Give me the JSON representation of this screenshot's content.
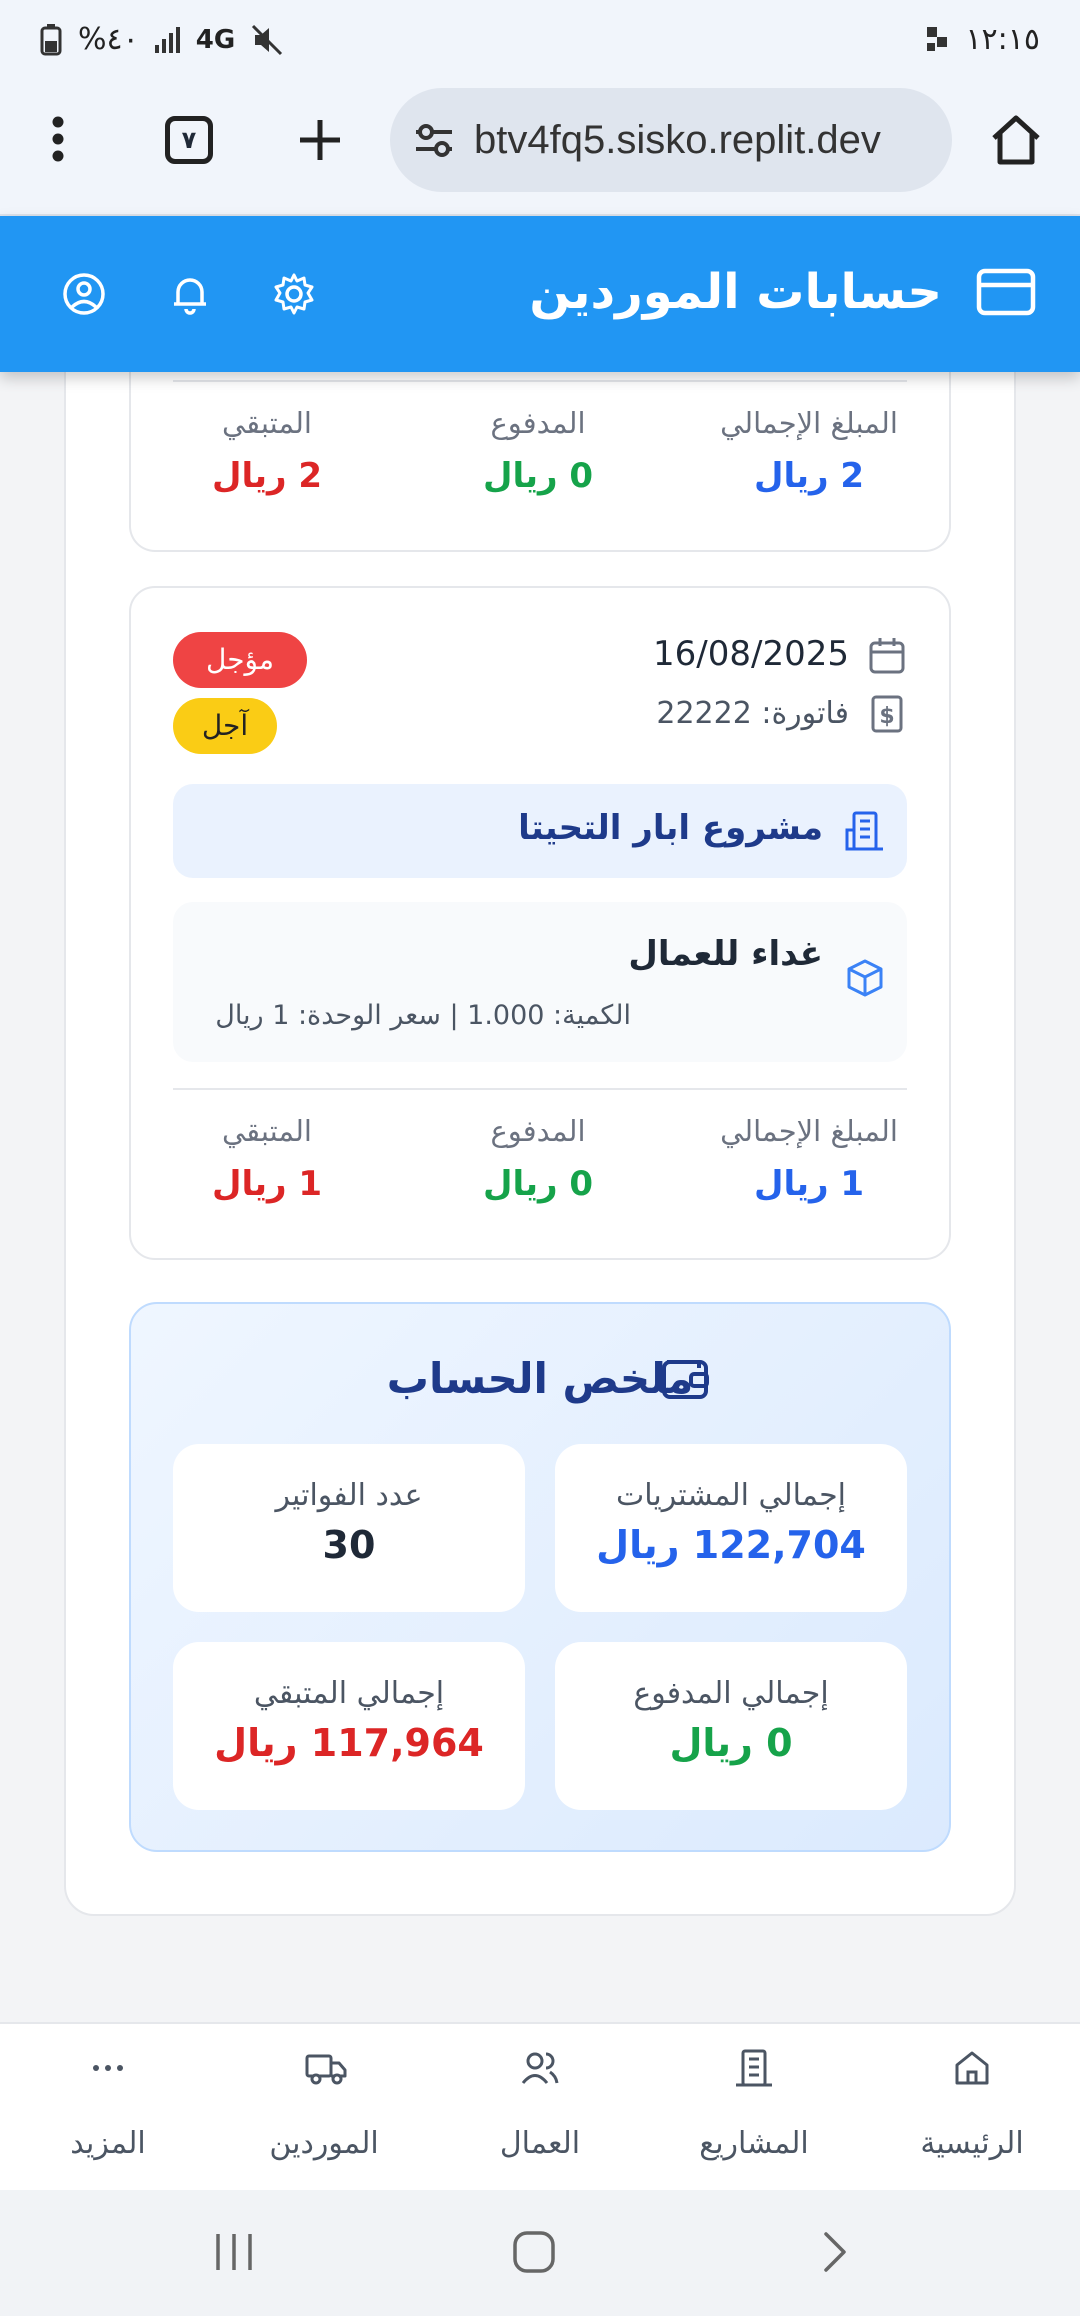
{
  "status_bar": {
    "time": "١٢:١٥",
    "battery": "%٤٠",
    "network": "4G"
  },
  "browser": {
    "url": "btv4fq5.sisko.replit.dev",
    "tab_count": "٧"
  },
  "header": {
    "title": "حسابات الموردين"
  },
  "invoice_top": {
    "total_label": "المبلغ الإجمالي",
    "total_value": "2 ريال",
    "paid_label": "المدفوع",
    "paid_value": "0 ريال",
    "remaining_label": "المتبقي",
    "remaining_value": "2 ريال"
  },
  "invoice": {
    "date": "16/08/2025",
    "invoice_number": "فاتورة: 22222",
    "status_badge": "مؤجل",
    "payment_badge": "آجل",
    "project": "مشروع ابار التحيتا",
    "item_name": "غداء للعمال",
    "item_details": "الكمية: 1.000 | سعر الوحدة: 1 ريال",
    "total_label": "المبلغ الإجمالي",
    "total_value": "1 ريال",
    "paid_label": "المدفوع",
    "paid_value": "0 ريال",
    "remaining_label": "المتبقي",
    "remaining_value": "1 ريال"
  },
  "summary": {
    "title": "ملخص الحساب",
    "total_purchases_label": "إجمالي المشتريات",
    "total_purchases_value": "122,704 ريال",
    "invoice_count_label": "عدد الفواتير",
    "invoice_count_value": "30",
    "total_paid_label": "إجمالي المدفوع",
    "total_paid_value": "0 ريال",
    "total_remaining_label": "إجمالي المتبقي",
    "total_remaining_value": "117,964 ريال"
  },
  "bottom_nav": {
    "items": [
      {
        "label": "الرئيسية",
        "icon": "home-icon"
      },
      {
        "label": "المشاريع",
        "icon": "building-icon"
      },
      {
        "label": "العمال",
        "icon": "users-icon"
      },
      {
        "label": "الموردين",
        "icon": "truck-icon"
      },
      {
        "label": "المزيد",
        "icon": "more-icon"
      }
    ]
  },
  "colors": {
    "primary": "#2196f3",
    "amount_total": "#2563eb",
    "amount_paid": "#16a34a",
    "amount_remaining": "#dc2626",
    "badge_deferred": "#ef4444",
    "badge_credit": "#facc15"
  }
}
